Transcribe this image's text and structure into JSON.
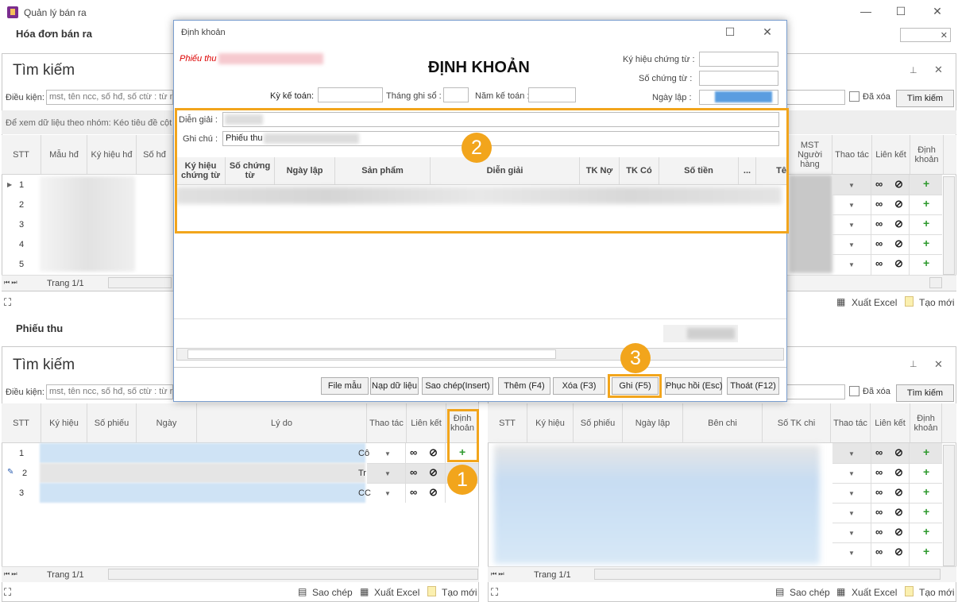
{
  "window": {
    "title": "Quản lý bán ra",
    "min": "—",
    "max": "☐",
    "close": "✕"
  },
  "top_section": {
    "title": "Hóa đơn bán ra",
    "close": "✕"
  },
  "search": {
    "title": "Tìm kiếm",
    "dieu_kien": "Điều kiện:",
    "placeholder": "mst, tên ncc, số hđ, số ctừ : từ n",
    "placeholder_short": "mst, tên ncc, số hđ, số ctừ : từ r",
    "da_xoa": "Đã xóa",
    "btn": "Tìm kiếm",
    "pin": "📌",
    "close": "✕"
  },
  "group_hint": "Để xem dữ liệu theo nhóm: Kéo tiêu đề cột n",
  "grid_top": {
    "headers": [
      "STT",
      "Mẫu hđ",
      "Ký hiệu hđ",
      "Số hđ"
    ],
    "right_headers": [
      "MST Người hàng",
      "Thao tác",
      "Liên kết",
      "Định khoản"
    ],
    "rows": [
      "1",
      "2",
      "3",
      "4",
      "5"
    ],
    "pager": "Trang 1/1"
  },
  "footer_top": {
    "xuat_excel": "Xuất Excel",
    "tao_moi": "Tạo mới"
  },
  "phieu_thu_section": {
    "title": "Phiếu thu"
  },
  "grid_left": {
    "headers": [
      "STT",
      "Ký hiệu",
      "Số phiếu",
      "Ngày",
      "Lý do",
      "Thao tác",
      "Liên kết",
      "Định khoản"
    ],
    "rows": [
      {
        "n": "1",
        "ly": "Cô"
      },
      {
        "n": "2",
        "ly": "Tr"
      },
      {
        "n": "3",
        "ly": "CC"
      }
    ],
    "pager": "Trang 1/1"
  },
  "grid_right": {
    "headers": [
      "STT",
      "Ký hiệu",
      "Số phiếu",
      "Ngày lập",
      "Bên chi",
      "Số TK chi",
      "Thao tác",
      "Liên kết",
      "Định khoản"
    ],
    "pager": "Trang 1/1"
  },
  "footer_bottom": {
    "sao_chep": "Sao chép",
    "xuat_excel": "Xuất Excel",
    "tao_moi": "Tạo mới"
  },
  "dialog": {
    "title": "Định khoản",
    "heading": "ĐỊNH KHOẢN",
    "phieu_thu": "Phiếu thu",
    "ky_hieu_label": "Ký hiệu chứng từ :",
    "so_chung_tu_label": "Số chứng từ :",
    "ngay_lap_label": "Ngày lập :",
    "ky_ke_toan_label": "Kỳ kế toán:",
    "thang_ghi_so_label": "Tháng ghi sổ :",
    "nam_ke_toan_label": "Năm kế toán :",
    "dien_giai_label": "Diễn giải :",
    "ghi_chu_label": "Ghi chú :",
    "ghi_chu_value": "Phiếu thu",
    "headers": [
      "Ký hiệu chứng từ",
      "Số chứng từ",
      "Ngày lập",
      "Sản phẩm",
      "Diễn giải",
      "TK Nợ",
      "TK Có",
      "Số tiền",
      "...",
      "Tê"
    ],
    "buttons": [
      "File mẫu",
      "Nạp dữ liệu",
      "Sao chép(Insert)",
      "Thêm (F4)",
      "Xóa (F3)",
      "Ghi (F5)",
      "Phục hồi (Esc)",
      "Thoát (F12)"
    ]
  },
  "badges": [
    "1",
    "2",
    "3"
  ],
  "colors": {
    "accent": "#f2a51c",
    "selection": "#cfe3f5",
    "plus": "#2e9a2e"
  }
}
